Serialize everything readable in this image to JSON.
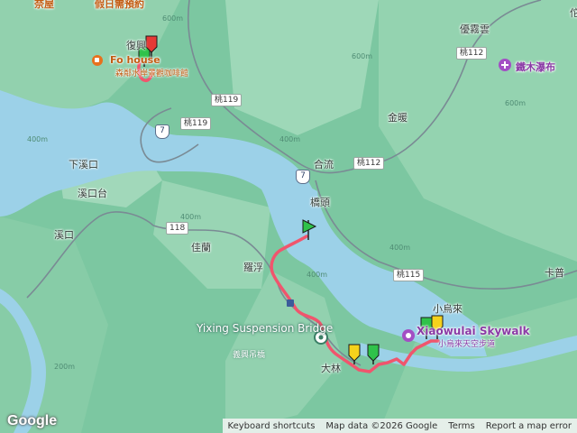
{
  "map": {
    "labels": {
      "top_left_partial": "奈屋",
      "top_holiday": "假日需預約",
      "fu_xing": "復興",
      "forest_house_cn": "森鄰水岸景觀咖啡館",
      "youluoyun": "優霧雲",
      "tiemu_falls": "鐵木瀑布",
      "jin_nuan": "金暖",
      "he_liu": "合流",
      "xia_xikou": "下溪口",
      "xikou_tai": "溪口台",
      "qiao_tou": "橋頭",
      "xi_kou": "溪口",
      "jia_lan": "佳蘭",
      "luo_fu": "羅浮",
      "ka_pu": "卡普",
      "xiao_wu_lai": "小烏來",
      "skywalk_cn": "小烏來天空步道",
      "da_lin": "大林",
      "yixing_en": "Yixing Suspension Bridge",
      "yixing_cn": "義興吊橋",
      "top_right_partial": "佗"
    },
    "poi": {
      "forest_house": "Fo    house",
      "skywalk": "Xiaowulai Skywalk"
    },
    "road_shields": {
      "t112_top": "桃112",
      "t119_a": "桃119",
      "t119_b": "桃119",
      "t112_mid": "桃112",
      "t118": "118",
      "t115": "桃115",
      "hw7_a": "7",
      "hw7_b": "7"
    },
    "contours": [
      "600m",
      "400m",
      "400m",
      "600m",
      "400m",
      "600m",
      "200m",
      "400m",
      "400m"
    ]
  },
  "footer": {
    "keyboard": "Keyboard shortcuts",
    "map_data": "Map data ©2026 Google",
    "terms": "Terms",
    "report": "Report a map error"
  },
  "logo": "Google"
}
